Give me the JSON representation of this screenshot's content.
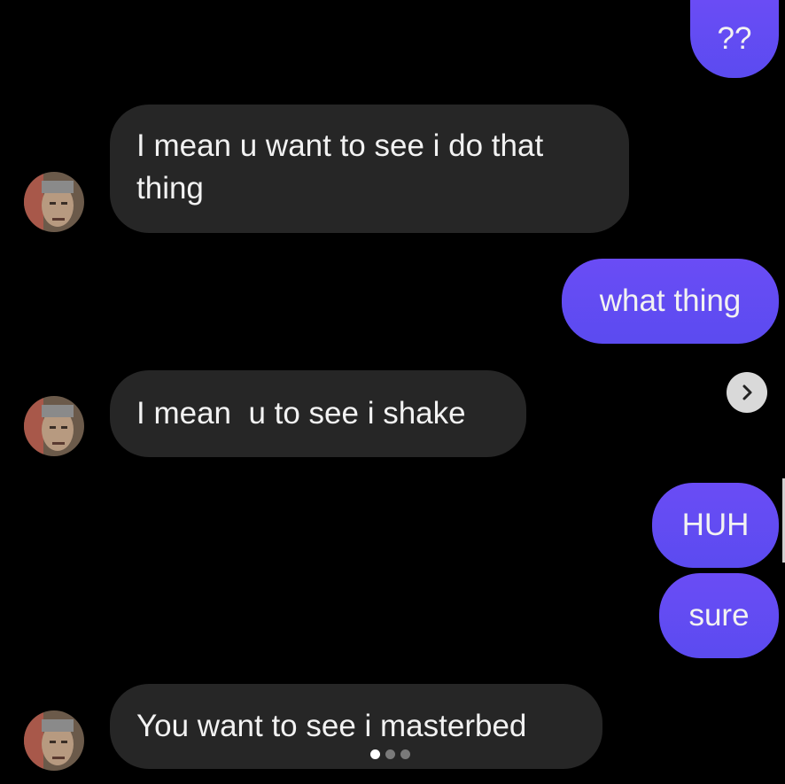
{
  "colors": {
    "background": "#000000",
    "incoming_bubble": "#262626",
    "outgoing_bubble": "#5b4bf0",
    "text": "#f2f2f2"
  },
  "messages": [
    {
      "direction": "outgoing",
      "text": "??"
    },
    {
      "direction": "incoming",
      "text_lines": [
        "I mean u want to see i do that",
        "thing"
      ]
    },
    {
      "direction": "outgoing",
      "text": "what thing"
    },
    {
      "direction": "incoming",
      "text": "I mean  u to see i shake"
    },
    {
      "direction": "outgoing",
      "text": "HUH"
    },
    {
      "direction": "outgoing",
      "text": "sure"
    },
    {
      "direction": "incoming",
      "text": "You want to see i masterbed"
    }
  ],
  "icons": {
    "forward": "chevron-right-icon",
    "avatar": "contact-avatar"
  },
  "pagination": {
    "total": 3,
    "active_index": 0
  }
}
